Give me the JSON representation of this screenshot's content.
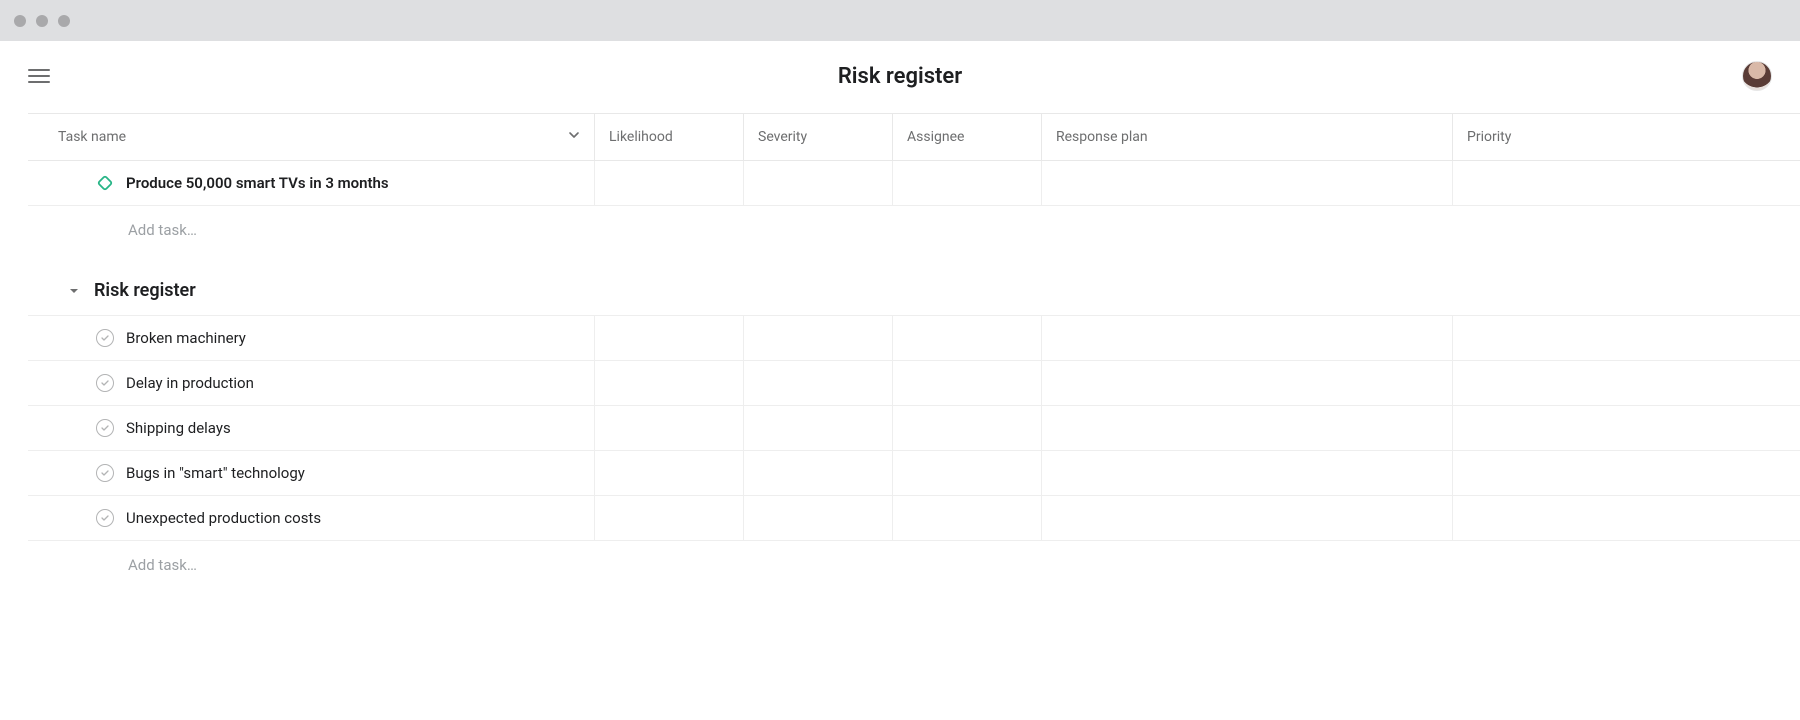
{
  "window": {
    "title": "Risk register"
  },
  "columns": {
    "task_name": "Task name",
    "likelihood": "Likelihood",
    "severity": "Severity",
    "assignee": "Assignee",
    "response_plan": "Response plan",
    "priority": "Priority"
  },
  "milestone": {
    "name": "Produce 50,000 smart TVs in 3 months"
  },
  "add_task_label": "Add task…",
  "section": {
    "title": "Risk register",
    "tasks": [
      {
        "name": "Broken machinery"
      },
      {
        "name": "Delay in production"
      },
      {
        "name": "Shipping delays"
      },
      {
        "name": "Bugs in \"smart\" technology"
      },
      {
        "name": "Unexpected production costs"
      }
    ]
  }
}
